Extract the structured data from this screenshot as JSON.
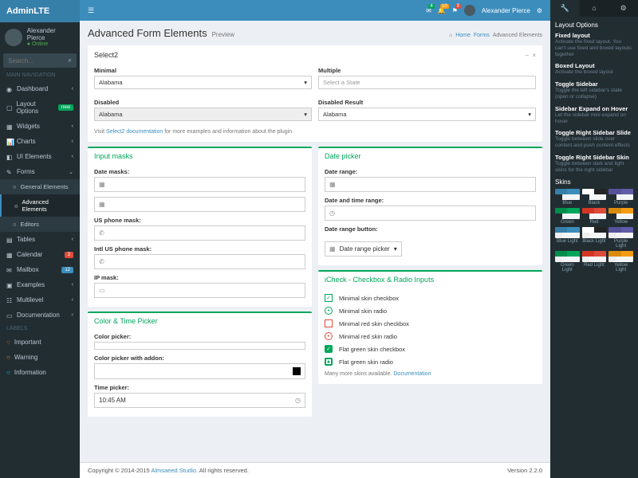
{
  "logo": "AdminLTE",
  "user": {
    "name": "Alexander Pierce",
    "status": "Online"
  },
  "search": {
    "placeholder": "Search..."
  },
  "nav": {
    "header1": "MAIN NAVIGATION",
    "items": [
      {
        "label": "Dashboard",
        "icon": "◉"
      },
      {
        "label": "Layout Options",
        "icon": "▢",
        "badge": "new"
      },
      {
        "label": "Widgets",
        "icon": "▦"
      },
      {
        "label": "Charts",
        "icon": "📊"
      },
      {
        "label": "UI Elements",
        "icon": "◧"
      },
      {
        "label": "Forms",
        "icon": "✎"
      },
      {
        "label": "Tables",
        "icon": "▤"
      },
      {
        "label": "Calendar",
        "icon": "▦",
        "badgeR": "3"
      },
      {
        "label": "Mailbox",
        "icon": "✉",
        "badgeB": "12"
      },
      {
        "label": "Examples",
        "icon": "▣"
      },
      {
        "label": "Multilevel",
        "icon": "☷"
      },
      {
        "label": "Documentation",
        "icon": "▭"
      }
    ],
    "sub": [
      {
        "label": "General Elements"
      },
      {
        "label": "Advanced Elements"
      },
      {
        "label": "Editors"
      }
    ],
    "header2": "LABELS",
    "labels": [
      {
        "label": "Important",
        "c": "#dd4b39"
      },
      {
        "label": "Warning",
        "c": "#f39c12"
      },
      {
        "label": "Information",
        "c": "#00c0ef"
      }
    ]
  },
  "topbar": {
    "user": "Alexander Pierce"
  },
  "header": {
    "title": "Advanced Form Elements",
    "subtitle": "Preview"
  },
  "breadcrumb": {
    "home": "Home",
    "forms": "Forms",
    "current": "Advanced Elements"
  },
  "select2": {
    "title": "Select2",
    "minimal": {
      "label": "Minimal",
      "value": "Alabama"
    },
    "disabled": {
      "label": "Disabled",
      "value": "Alabama"
    },
    "multiple": {
      "label": "Multiple",
      "placeholder": "Select a State"
    },
    "disabledResult": {
      "label": "Disabled Result",
      "value": "Alabama"
    },
    "help": "Visit ",
    "helpLink": "Select2 documentation",
    "help2": " for more examples and information about the plugin."
  },
  "masks": {
    "title": "Input masks",
    "date": "Date masks:",
    "usPhone": "US phone mask:",
    "intlPhone": "Intl US phone mask:",
    "ip": "IP mask:"
  },
  "color": {
    "title": "Color & Time Picker",
    "picker": "Color picker:",
    "addon": "Color picker with addon:",
    "time": "Time picker:",
    "timeVal": "10:45 AM"
  },
  "date": {
    "title": "Date picker",
    "range": "Date range:",
    "dateTime": "Date and time range:",
    "button": "Date range button:",
    "buttonLabel": "Date range picker"
  },
  "icheck": {
    "title": "iCheck - Checkbox & Radio Inputs",
    "items": [
      "Minimal skin checkbox",
      "Minimal skin radio",
      "Minimal red skin checkbox",
      "Minimal red skin radio",
      "Flat green skin checkbox",
      "Flat green skin radio"
    ],
    "help": "Many more skins available. ",
    "helpLink": "Documentation"
  },
  "footer": {
    "copyright": "Copyright © 2014-2015 ",
    "studio": "Almsaeed Studio",
    "rights": ". All rights reserved.",
    "version": "Version 2.2.0"
  },
  "rightPanel": {
    "title": "Layout Options",
    "opts": [
      {
        "label": "Fixed layout",
        "desc": "Activate the fixed layout. You can't use fixed and boxed layouts together"
      },
      {
        "label": "Boxed Layout",
        "desc": "Activate the boxed layout"
      },
      {
        "label": "Toggle Sidebar",
        "desc": "Toggle the left sidebar's state (open or collapse)"
      },
      {
        "label": "Sidebar Expand on Hover",
        "desc": "Let the sidebar mini expand on hover"
      },
      {
        "label": "Toggle Right Sidebar Slide",
        "desc": "Toggle between slide over content and push content effects"
      },
      {
        "label": "Toggle Right Sidebar Skin",
        "desc": "Toggle between dark and light skins for the right sidebar"
      }
    ],
    "skinsTitle": "Skins",
    "skins": [
      {
        "label": "Blue",
        "a": "#367fa9",
        "b": "#3c8dbc"
      },
      {
        "label": "Black",
        "a": "#fefefe",
        "b": "#222"
      },
      {
        "label": "Purple",
        "a": "#555299",
        "b": "#605ca8"
      },
      {
        "label": "Green",
        "a": "#008d4c",
        "b": "#00a65a"
      },
      {
        "label": "Red",
        "a": "#d33724",
        "b": "#dd4b39"
      },
      {
        "label": "Yellow",
        "a": "#db8b0b",
        "b": "#f39c12"
      },
      {
        "label": "Blue Light",
        "a": "#367fa9",
        "b": "#3c8dbc"
      },
      {
        "label": "Black Light",
        "a": "#fefefe",
        "b": "#222"
      },
      {
        "label": "Purple Light",
        "a": "#555299",
        "b": "#605ca8"
      },
      {
        "label": "Green Light",
        "a": "#008d4c",
        "b": "#00a65a"
      },
      {
        "label": "Red Light",
        "a": "#d33724",
        "b": "#dd4b39"
      },
      {
        "label": "Yellow Light",
        "a": "#db8b0b",
        "b": "#f39c12"
      }
    ]
  }
}
